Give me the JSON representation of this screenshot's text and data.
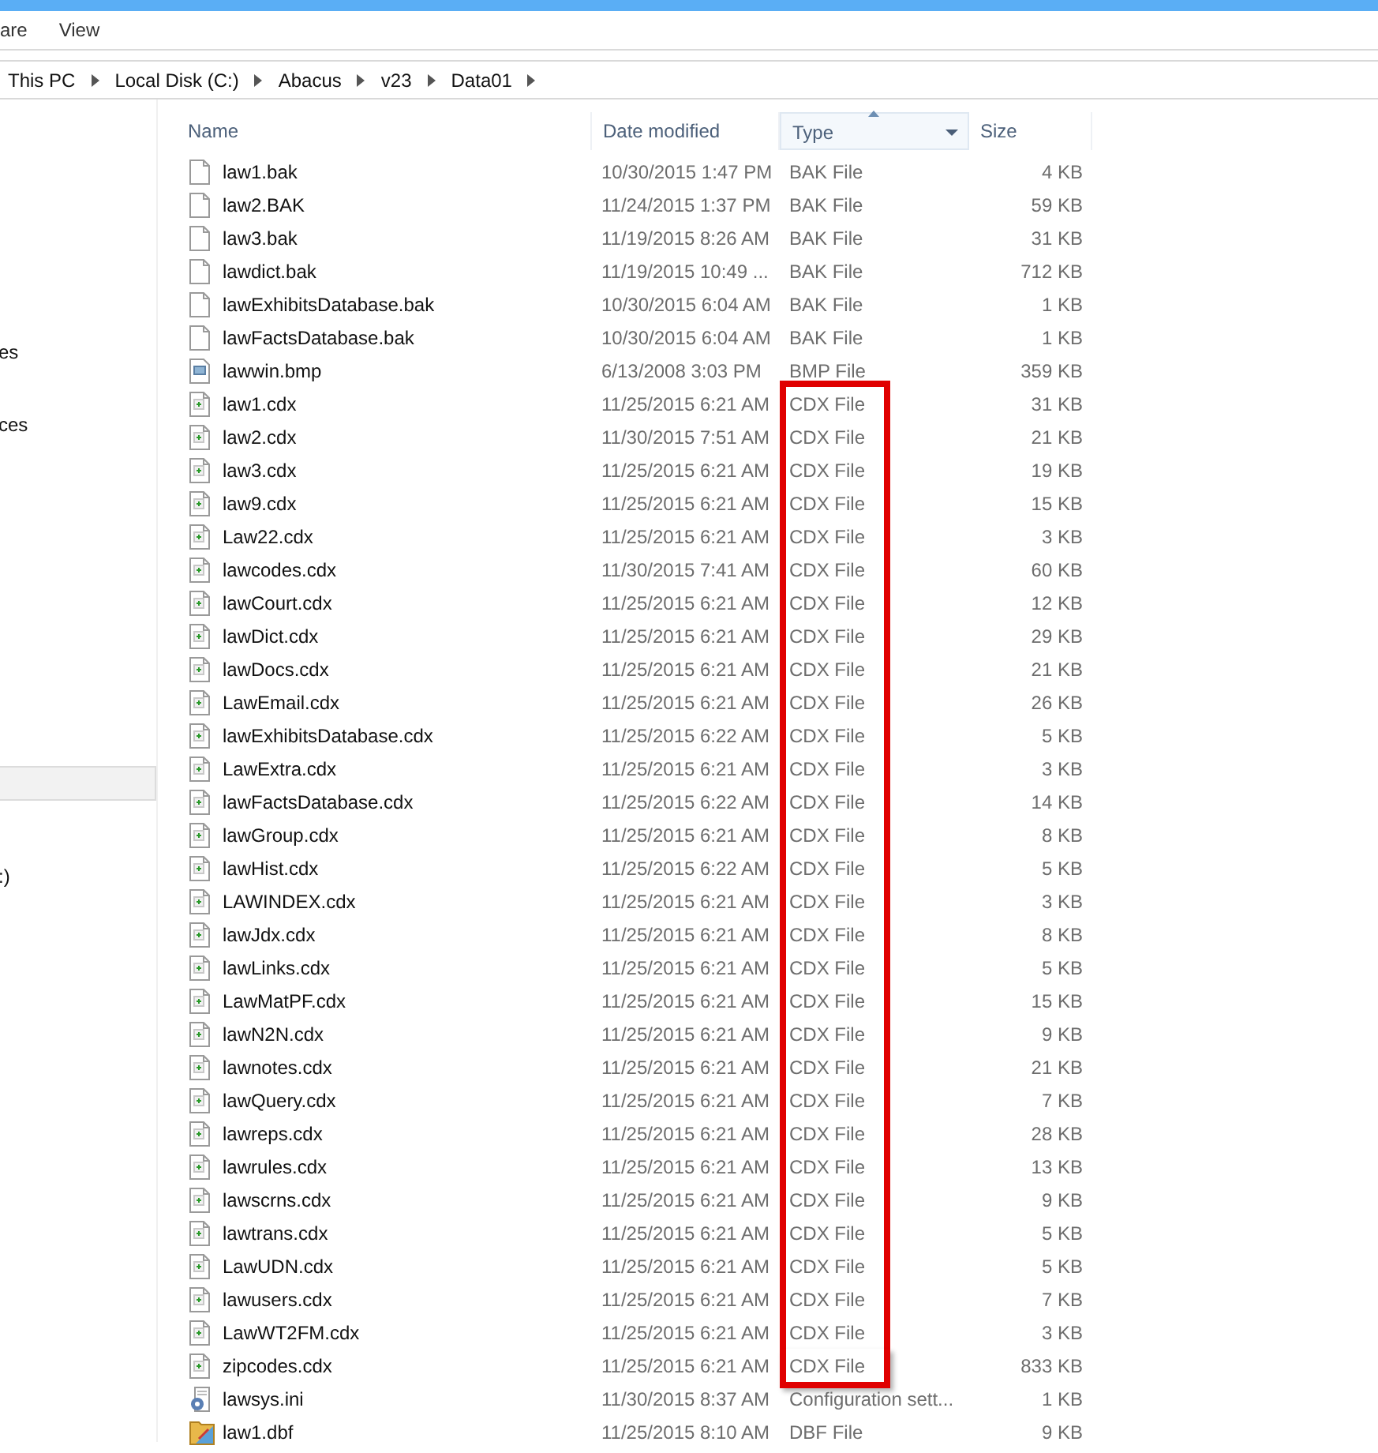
{
  "ribbon": {
    "tabs": [
      {
        "label": "are",
        "selected": false
      },
      {
        "label": "View",
        "selected": false
      }
    ]
  },
  "address_bar": {
    "crumbs": [
      "This PC",
      "Local Disk (C:)",
      "Abacus",
      "v23",
      "Data01"
    ]
  },
  "nav_pane": {
    "items": [
      {
        "label": "es",
        "selected": false
      },
      {
        "label": "ces",
        "selected": false
      },
      {
        "selected": true
      },
      {
        "label": ":)",
        "selected": false
      }
    ]
  },
  "columns": [
    {
      "label": "Name",
      "sorted": false
    },
    {
      "label": "Date modified",
      "sorted": false
    },
    {
      "label": "Type",
      "sorted": true
    },
    {
      "label": "Size",
      "sorted": false
    }
  ],
  "rows": [
    {
      "kind": "blank",
      "name": "law1.bak",
      "date": "10/30/2015 1:47 PM",
      "type": "BAK File",
      "size": "4 KB",
      "marked": false
    },
    {
      "kind": "blank",
      "name": "law2.BAK",
      "date": "11/24/2015 1:37 PM",
      "type": "BAK File",
      "size": "59 KB",
      "marked": false
    },
    {
      "kind": "blank",
      "name": "law3.bak",
      "date": "11/19/2015 8:26 AM",
      "type": "BAK File",
      "size": "31 KB",
      "marked": false
    },
    {
      "kind": "blank",
      "name": "lawdict.bak",
      "date": "11/19/2015 10:49 ...",
      "type": "BAK File",
      "size": "712 KB",
      "marked": false
    },
    {
      "kind": "blank",
      "name": "lawExhibitsDatabase.bak",
      "date": "10/30/2015 6:04 AM",
      "type": "BAK File",
      "size": "1 KB",
      "marked": false
    },
    {
      "kind": "blank",
      "name": "lawFactsDatabase.bak",
      "date": "10/30/2015 6:04 AM",
      "type": "BAK File",
      "size": "1 KB",
      "marked": false
    },
    {
      "kind": "image",
      "name": "lawwin.bmp",
      "date": "6/13/2008 3:03 PM",
      "type": "BMP File",
      "size": "359 KB",
      "marked": false
    },
    {
      "kind": "cdx",
      "name": "law1.cdx",
      "date": "11/25/2015 6:21 AM",
      "type": "CDX File",
      "size": "31 KB",
      "marked": true
    },
    {
      "kind": "cdx",
      "name": "law2.cdx",
      "date": "11/30/2015 7:51 AM",
      "type": "CDX File",
      "size": "21 KB",
      "marked": true
    },
    {
      "kind": "cdx",
      "name": "law3.cdx",
      "date": "11/25/2015 6:21 AM",
      "type": "CDX File",
      "size": "19 KB",
      "marked": true
    },
    {
      "kind": "cdx",
      "name": "law9.cdx",
      "date": "11/25/2015 6:21 AM",
      "type": "CDX File",
      "size": "15 KB",
      "marked": true
    },
    {
      "kind": "cdx",
      "name": "Law22.cdx",
      "date": "11/25/2015 6:21 AM",
      "type": "CDX File",
      "size": "3 KB",
      "marked": true
    },
    {
      "kind": "cdx",
      "name": "lawcodes.cdx",
      "date": "11/30/2015 7:41 AM",
      "type": "CDX File",
      "size": "60 KB",
      "marked": true
    },
    {
      "kind": "cdx",
      "name": "lawCourt.cdx",
      "date": "11/25/2015 6:21 AM",
      "type": "CDX File",
      "size": "12 KB",
      "marked": true
    },
    {
      "kind": "cdx",
      "name": "lawDict.cdx",
      "date": "11/25/2015 6:21 AM",
      "type": "CDX File",
      "size": "29 KB",
      "marked": true
    },
    {
      "kind": "cdx",
      "name": "lawDocs.cdx",
      "date": "11/25/2015 6:21 AM",
      "type": "CDX File",
      "size": "21 KB",
      "marked": true
    },
    {
      "kind": "cdx",
      "name": "LawEmail.cdx",
      "date": "11/25/2015 6:21 AM",
      "type": "CDX File",
      "size": "26 KB",
      "marked": true
    },
    {
      "kind": "cdx",
      "name": "lawExhibitsDatabase.cdx",
      "date": "11/25/2015 6:22 AM",
      "type": "CDX File",
      "size": "5 KB",
      "marked": true
    },
    {
      "kind": "cdx",
      "name": "LawExtra.cdx",
      "date": "11/25/2015 6:21 AM",
      "type": "CDX File",
      "size": "3 KB",
      "marked": true
    },
    {
      "kind": "cdx",
      "name": "lawFactsDatabase.cdx",
      "date": "11/25/2015 6:22 AM",
      "type": "CDX File",
      "size": "14 KB",
      "marked": true
    },
    {
      "kind": "cdx",
      "name": "lawGroup.cdx",
      "date": "11/25/2015 6:21 AM",
      "type": "CDX File",
      "size": "8 KB",
      "marked": true
    },
    {
      "kind": "cdx",
      "name": "lawHist.cdx",
      "date": "11/25/2015 6:22 AM",
      "type": "CDX File",
      "size": "5 KB",
      "marked": true
    },
    {
      "kind": "cdx",
      "name": "LAWINDEX.cdx",
      "date": "11/25/2015 6:21 AM",
      "type": "CDX File",
      "size": "3 KB",
      "marked": true
    },
    {
      "kind": "cdx",
      "name": "lawJdx.cdx",
      "date": "11/25/2015 6:21 AM",
      "type": "CDX File",
      "size": "8 KB",
      "marked": true
    },
    {
      "kind": "cdx",
      "name": "lawLinks.cdx",
      "date": "11/25/2015 6:21 AM",
      "type": "CDX File",
      "size": "5 KB",
      "marked": true
    },
    {
      "kind": "cdx",
      "name": "LawMatPF.cdx",
      "date": "11/25/2015 6:21 AM",
      "type": "CDX File",
      "size": "15 KB",
      "marked": true
    },
    {
      "kind": "cdx",
      "name": "lawN2N.cdx",
      "date": "11/25/2015 6:21 AM",
      "type": "CDX File",
      "size": "9 KB",
      "marked": true
    },
    {
      "kind": "cdx",
      "name": "lawnotes.cdx",
      "date": "11/25/2015 6:21 AM",
      "type": "CDX File",
      "size": "21 KB",
      "marked": true
    },
    {
      "kind": "cdx",
      "name": "lawQuery.cdx",
      "date": "11/25/2015 6:21 AM",
      "type": "CDX File",
      "size": "7 KB",
      "marked": true
    },
    {
      "kind": "cdx",
      "name": "lawreps.cdx",
      "date": "11/25/2015 6:21 AM",
      "type": "CDX File",
      "size": "28 KB",
      "marked": true
    },
    {
      "kind": "cdx",
      "name": "lawrules.cdx",
      "date": "11/25/2015 6:21 AM",
      "type": "CDX File",
      "size": "13 KB",
      "marked": true
    },
    {
      "kind": "cdx",
      "name": "lawscrns.cdx",
      "date": "11/25/2015 6:21 AM",
      "type": "CDX File",
      "size": "9 KB",
      "marked": true
    },
    {
      "kind": "cdx",
      "name": "lawtrans.cdx",
      "date": "11/25/2015 6:21 AM",
      "type": "CDX File",
      "size": "5 KB",
      "marked": true
    },
    {
      "kind": "cdx",
      "name": "LawUDN.cdx",
      "date": "11/25/2015 6:21 AM",
      "type": "CDX File",
      "size": "5 KB",
      "marked": true
    },
    {
      "kind": "cdx",
      "name": "lawusers.cdx",
      "date": "11/25/2015 6:21 AM",
      "type": "CDX File",
      "size": "7 KB",
      "marked": true
    },
    {
      "kind": "cdx",
      "name": "LawWT2FM.cdx",
      "date": "11/25/2015 6:21 AM",
      "type": "CDX File",
      "size": "3 KB",
      "marked": true
    },
    {
      "kind": "cdx",
      "name": "zipcodes.cdx",
      "date": "11/25/2015 6:21 AM",
      "type": "CDX File",
      "size": "833 KB",
      "marked": true
    },
    {
      "kind": "config",
      "name": "lawsys.ini",
      "date": "11/30/2015 8:37 AM",
      "type": "Configuration sett...",
      "size": "1 KB",
      "marked": false
    },
    {
      "kind": "database",
      "name": "law1.dbf",
      "date": "11/25/2015 8:10 AM",
      "type": "DBF File",
      "size": "9 KB",
      "marked": false
    }
  ]
}
